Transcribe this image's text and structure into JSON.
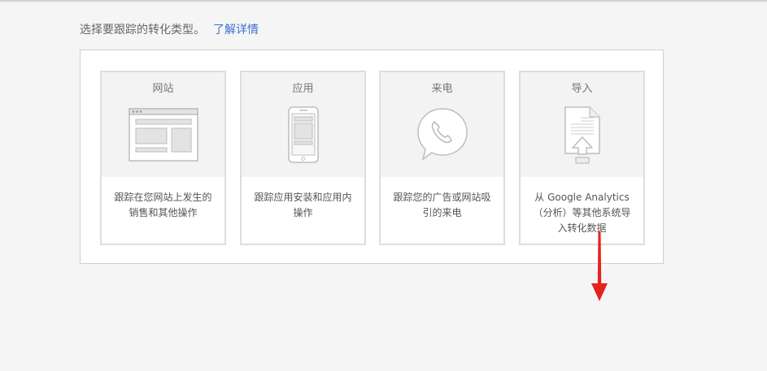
{
  "intro": {
    "text": "选择要跟踪的转化类型。",
    "learn_more": "了解详情"
  },
  "cards": [
    {
      "title": "网站",
      "icon": "website-icon",
      "desc": "跟踪在您网站上发生的销售和其他操作"
    },
    {
      "title": "应用",
      "icon": "mobile-app-icon",
      "desc": "跟踪应用安装和应用内操作"
    },
    {
      "title": "来电",
      "icon": "phone-call-icon",
      "desc": "跟踪您的广告或网站吸引的来电"
    },
    {
      "title": "导入",
      "icon": "import-file-icon",
      "desc": "从 Google Analytics（分析）等其他系统导入转化数据"
    }
  ],
  "colors": {
    "link": "#3f6fd3",
    "arrow": "#e5231e",
    "card_border": "#dedede",
    "card_top_bg": "#f3f3f3"
  }
}
